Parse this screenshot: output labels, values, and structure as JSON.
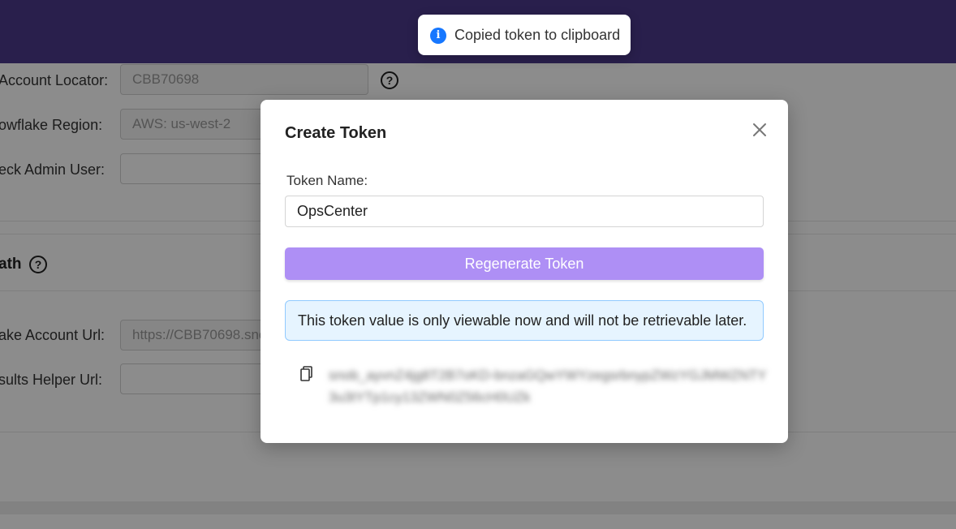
{
  "background": {
    "rows": [
      {
        "label": "Account Locator:",
        "value": "CBB70698",
        "help_icon": "help-circle-icon"
      },
      {
        "label": "owflake Region:",
        "value": "AWS: us-west-2"
      },
      {
        "label": "eck Admin User:",
        "value": ""
      }
    ],
    "section": {
      "title": "ath",
      "help_icon": "help-circle-icon"
    },
    "section_rows": [
      {
        "label": "ake Account Url:",
        "value": "https://CBB70698.sno"
      },
      {
        "label": "sults Helper Url:",
        "value": ""
      }
    ]
  },
  "modal": {
    "title": "Create Token",
    "close_icon": "close-icon",
    "field_label": "Token Name:",
    "token_name": "OpsCenter",
    "regenerate_label": "Regenerate Token",
    "alert_text": "This token value is only viewable now and will not be retrievable later.",
    "copy_icon": "copy-icon",
    "token_value": "snob_ayvnZ4jg8T2B7oKD-bnzaGQwYWYzegsrbnypZWzYGJMWZNTY3u3tYTp1cy13ZWN0Z56cH0UZk"
  },
  "toast": {
    "icon": "info-icon",
    "text": "Copied token to clipboard"
  },
  "colors": {
    "header": "#4b3a8a",
    "primary_button": "#ae8ff5",
    "info_bg": "#e6f4ff",
    "info_border": "#91caff",
    "toast_icon": "#1677ff"
  }
}
